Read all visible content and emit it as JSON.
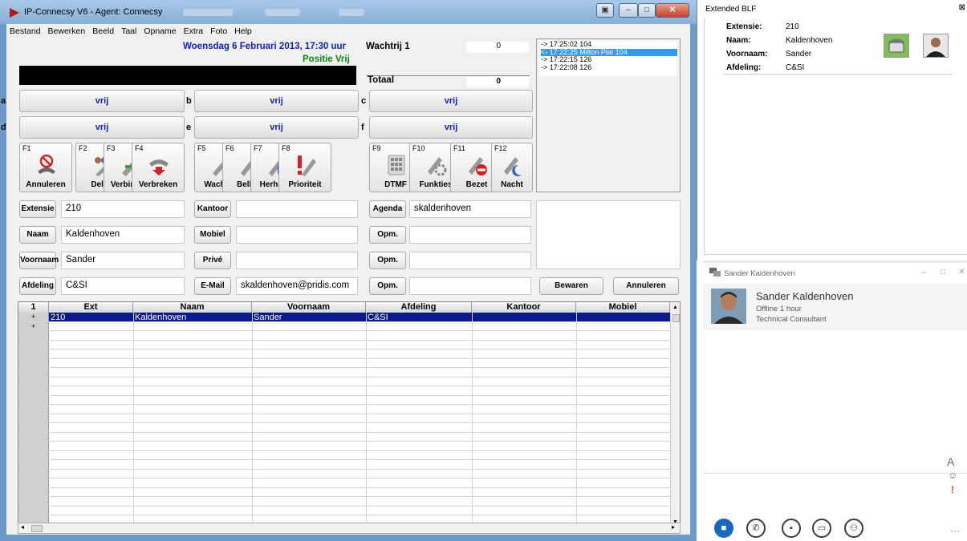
{
  "window": {
    "title": "IP-Connecsy V6 - Agent: Connecsy"
  },
  "menu": [
    "Bestand",
    "Bewerken",
    "Beeld",
    "Taal",
    "Opname",
    "Extra",
    "Foto",
    "Help"
  ],
  "header": {
    "datetime": "Woensdag 6 Februari 2013, 17:30 uur",
    "position": "Positie Vrij"
  },
  "queue": {
    "label": "Wachtrij 1",
    "value": "0",
    "total_label": "Totaal",
    "total_value": "0"
  },
  "calllog": [
    {
      "text": "-> 17:25:02  104",
      "selected": false
    },
    {
      "text": "<- 17:22:25  Milton Plat 104",
      "selected": true
    },
    {
      "text": "-> 17:22:15  126",
      "selected": false
    },
    {
      "text": "-> 17:22:08  126",
      "selected": false
    }
  ],
  "slots": [
    {
      "key": "a",
      "label": "vrij"
    },
    {
      "key": "b",
      "label": "vrij"
    },
    {
      "key": "c",
      "label": "vrij"
    },
    {
      "key": "d",
      "label": "vrij"
    },
    {
      "key": "e",
      "label": "vrij"
    },
    {
      "key": "f",
      "label": "vrij"
    }
  ],
  "fkeys": [
    {
      "key": "F1",
      "label": "Annuleren",
      "icon": "cancel-icon"
    },
    {
      "key": "F2",
      "label": "Delen",
      "icon": "share-icon"
    },
    {
      "key": "F3",
      "label": "Verbinden",
      "icon": "connect-icon"
    },
    {
      "key": "F4",
      "label": "Verbreken",
      "icon": "hangup-icon"
    },
    {
      "key": "F5",
      "label": "Wachten",
      "icon": "hold-icon"
    },
    {
      "key": "F6",
      "label": "Bellen",
      "icon": "call-icon"
    },
    {
      "key": "F7",
      "label": "Herhalen",
      "icon": "redial-icon"
    },
    {
      "key": "F8",
      "label": "Prioriteit",
      "icon": "priority-icon"
    },
    {
      "key": "F9",
      "label": "DTMF",
      "icon": "dtmf-icon"
    },
    {
      "key": "F10",
      "label": "Funkties",
      "icon": "functions-icon"
    },
    {
      "key": "F11",
      "label": "Bezet",
      "icon": "busy-icon"
    },
    {
      "key": "F12",
      "label": "Nacht",
      "icon": "night-icon"
    }
  ],
  "form": {
    "extensie_label": "Extensie",
    "extensie": "210",
    "naam_label": "Naam",
    "naam": "Kaldenhoven",
    "voornaam_label": "Voornaam",
    "voornaam": "Sander",
    "afdeling_label": "Afdeling",
    "afdeling": "C&SI",
    "kantoor_label": "Kantoor",
    "kantoor": "",
    "mobiel_label": "Mobiel",
    "mobiel": "",
    "prive_label": "Privé",
    "prive": "",
    "email_label": "E-Mail",
    "email": "skaldenhoven@pridis.com",
    "agenda_label": "Agenda",
    "agenda": "skaldenhoven",
    "opm_label": "Opm.",
    "save_label": "Bewaren",
    "cancel_label": "Annuleren"
  },
  "grid": {
    "corner": "1",
    "columns": [
      "Ext",
      "Naam",
      "Voornaam",
      "Afdeling",
      "Kantoor",
      "Mobiel"
    ],
    "rows": [
      {
        "marker": "+",
        "cells": [
          "210",
          "Kaldenhoven",
          "Sander",
          "C&SI",
          "",
          ""
        ]
      },
      {
        "marker": "+",
        "cells": [
          "",
          "",
          "",
          "",
          "",
          ""
        ]
      }
    ]
  },
  "blf": {
    "title": "Extended BLF",
    "extensie_label": "Extensie:",
    "extensie": "210",
    "naam_label": "Naam:",
    "naam": "Kaldenhoven",
    "voornaam_label": "Voornaam:",
    "voornaam": "Sander",
    "afdeling_label": "Afdeling:",
    "afdeling": "C&SI"
  },
  "lync": {
    "window_title": "Sander Kaldenhoven",
    "name": "Sander Kaldenhoven",
    "status": "Offline 1 hour",
    "role": "Technical Consultant",
    "side_icons": {
      "font": "A",
      "emoji": "☺",
      "important": "!"
    },
    "more": "···",
    "colors": {
      "im": "#1768c2",
      "important": "#e8490f"
    }
  }
}
